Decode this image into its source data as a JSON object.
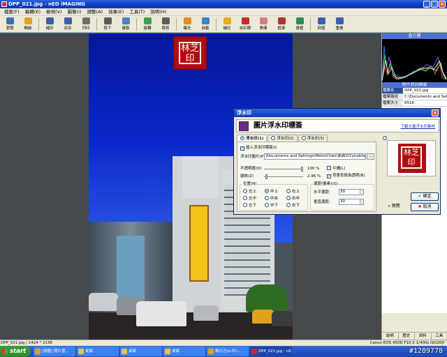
{
  "window": {
    "title": "DPP_021.jpg - nEO iMAGING",
    "controls": [
      "_",
      "□",
      "×"
    ]
  },
  "menu": [
    "檔案(F)",
    "編輯(E)",
    "檢視(V)",
    "圖像(I)",
    "調整(A)",
    "效果(E)",
    "工具(T)",
    "說明(H)"
  ],
  "toolbar": [
    {
      "label": "瀏覽",
      "icon": "browse-icon",
      "color": "#3d6fb6"
    },
    {
      "label": "開啟",
      "icon": "open-folder-icon",
      "color": "#d9a424"
    },
    {
      "label": "儲存",
      "icon": "save-icon",
      "color": "#3f5ea8"
    },
    {
      "label": "另存",
      "icon": "save-as-icon",
      "color": "#3f5ea8"
    },
    {
      "label": "列印",
      "icon": "print-icon",
      "color": "#6f6f6f"
    },
    {
      "label": "剪下",
      "icon": "cut-icon",
      "color": "#5a5a5a"
    },
    {
      "label": "複製",
      "icon": "copy-icon",
      "color": "#4e7fbf"
    },
    {
      "label": "旋轉",
      "icon": "rotate-icon",
      "color": "#3aa04c"
    },
    {
      "label": "裁剪",
      "icon": "crop-icon",
      "color": "#5d5d5d"
    },
    {
      "label": "曝光",
      "icon": "exposure-icon",
      "color": "#e28c1f"
    },
    {
      "label": "自動",
      "icon": "auto-icon",
      "color": "#3b83c9"
    },
    {
      "label": "補光",
      "icon": "fill-light-icon",
      "color": "#e0b020"
    },
    {
      "label": "去紅眼",
      "icon": "red-eye-icon",
      "color": "#c22c2c"
    },
    {
      "label": "美膚",
      "icon": "skin-icon",
      "color": "#d87a8d"
    },
    {
      "label": "框架",
      "icon": "frame-icon",
      "color": "#b2342c"
    },
    {
      "label": "邊框",
      "icon": "border-icon",
      "color": "#2a8a5a"
    },
    {
      "label": "回復",
      "icon": "undo-icon",
      "color": "#3b5fb5"
    },
    {
      "label": "重做",
      "icon": "redo-icon",
      "color": "#3b5fb5"
    }
  ],
  "photo": {
    "stamp_text": "林芝印"
  },
  "panel": {
    "histogram_title": "直方圖",
    "info_title": "照片資訊摘要",
    "info": [
      {
        "key": "檔案名",
        "value": "DPP_021.jpg"
      },
      {
        "key": "檔案路徑",
        "value": "C:\\Documents and Settings"
      },
      {
        "key": "檔案大小",
        "value": "651K"
      }
    ],
    "tabs": [
      "說明",
      "歷史",
      "資料",
      "工具"
    ]
  },
  "dialog": {
    "title": "浮水印",
    "header_title": "圖片浮水印標簽",
    "header_link": "下載大量浮水印素材",
    "tabs": [
      "浮水印(1)",
      "浮水印(2)",
      "浮水印(3)"
    ],
    "insert_label": "插入浮水印標簽(I)",
    "insert_checked": true,
    "file_label": "浮水印圖片(P)",
    "file_value": "\\Documents and Settings\\MetroChen\\桌面\\01\\mobile01",
    "opacity_label": "不透明度(O)",
    "opacity_value": "100 %",
    "opacity_level": 1.0,
    "scale_label": "縮放(Z)",
    "scale_value": "2.96 %",
    "scale_level": 0.0296,
    "tile_label": "平鋪(L)",
    "tile_checked": false,
    "transparent_label": "背景色設為透明(B)",
    "transparent_checked": true,
    "position_label": "位置(N)",
    "positions": [
      "左上",
      "中上",
      "右上",
      "左中",
      "中央",
      "右中",
      "左下",
      "中下",
      "右下"
    ],
    "position_selected": "中上",
    "margin_label": "邊距(像素)(G)",
    "h_margin_label": "水平邊距:",
    "h_margin_value": "30",
    "v_margin_label": "垂直邊距:",
    "v_margin_value": "30",
    "ok_label": "確定",
    "cancel_label": "取消",
    "preview_label": "預覽",
    "preview_stamp_text": "林芝印"
  },
  "status": {
    "left": "DPP_021.jpg | 1424 * 2136",
    "right": "Canon EOS 450D F10.0 1/400s ISO200"
  },
  "taskbar": {
    "start": "start",
    "tasks": [
      {
        "label": "[隨鑑] 照片管...",
        "color": "#d9a424",
        "active": false
      },
      {
        "label": "桌面",
        "color": "#e8c14a",
        "active": false
      },
      {
        "label": "桌面",
        "color": "#e8c14a",
        "active": false
      },
      {
        "label": "桌面",
        "color": "#e8c14a",
        "active": false
      },
      {
        "label": "無刃刃(s:中)-...",
        "color": "#d9a424",
        "active": false
      },
      {
        "label": "DPP_021.jpg - nE...",
        "color": "#c8283a",
        "active": true
      }
    ],
    "watermark": "#1289778"
  }
}
